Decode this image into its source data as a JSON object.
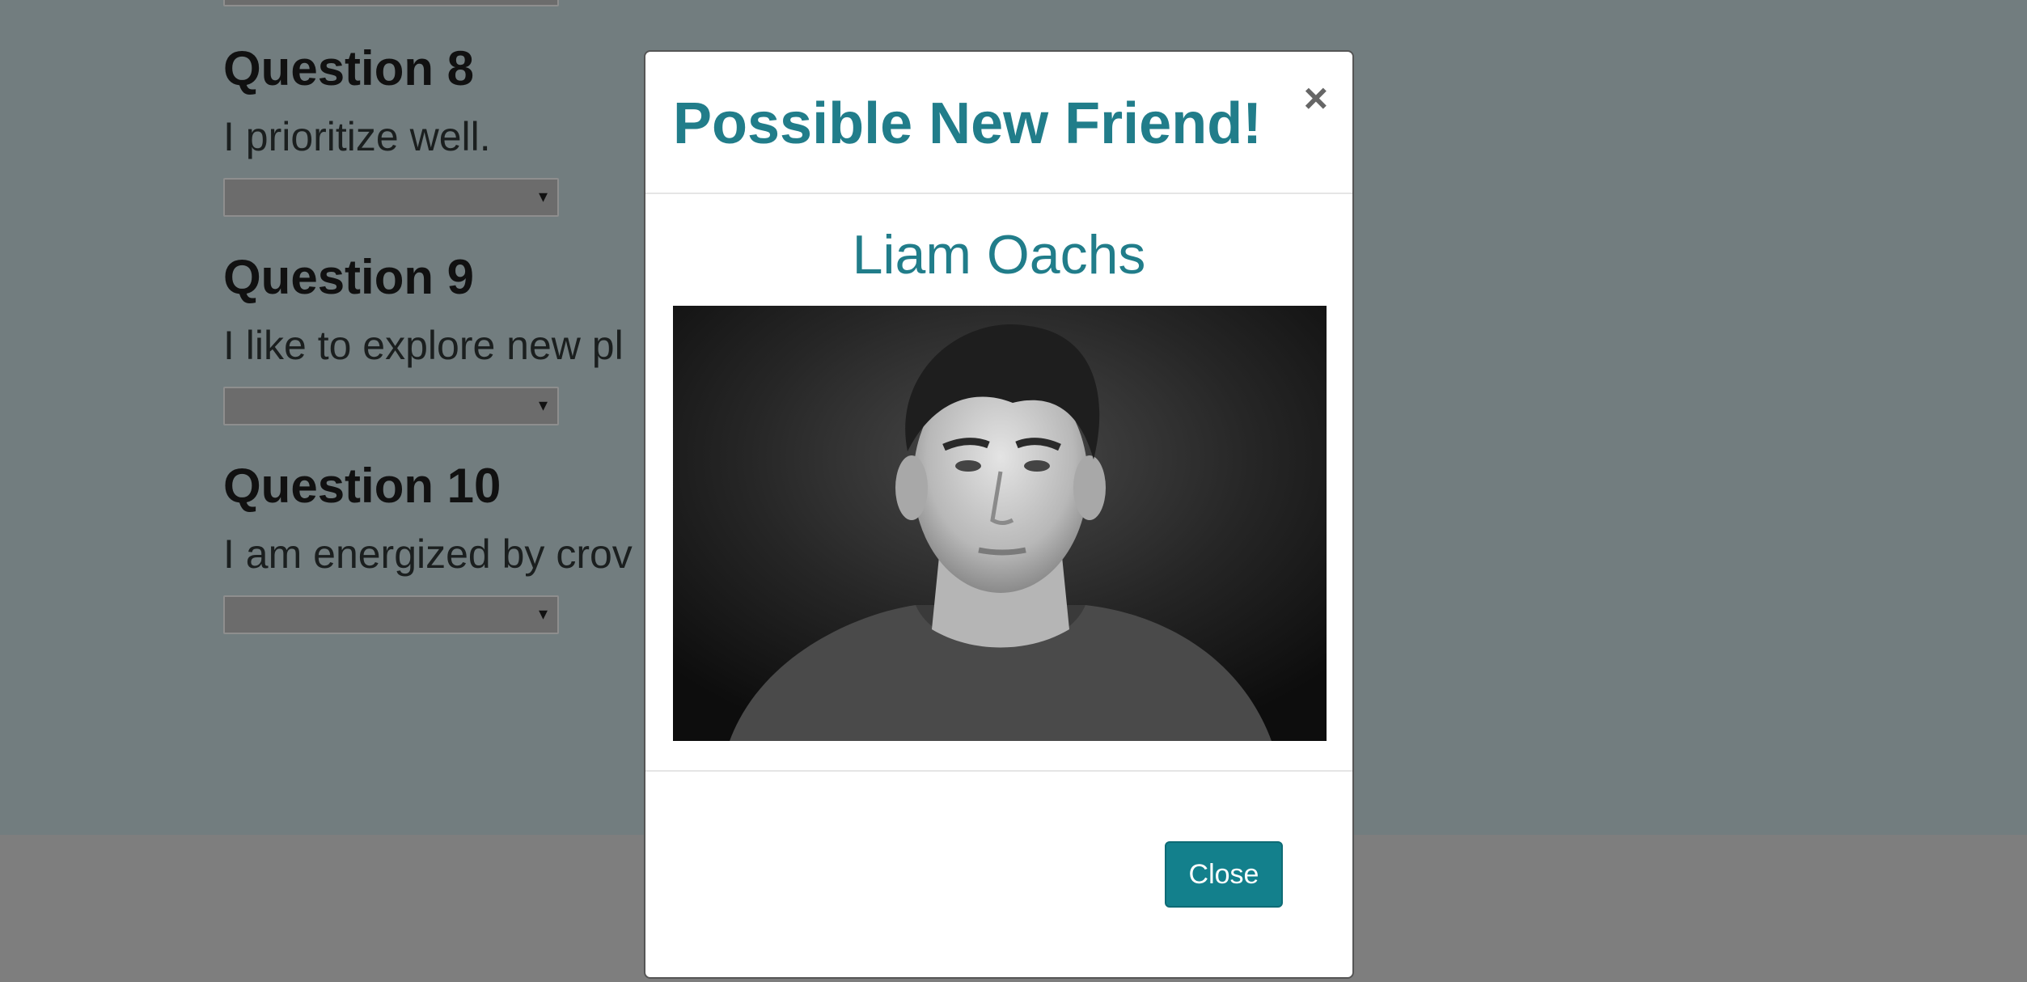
{
  "questions": [
    {
      "title": "Question 8",
      "text": "I prioritize well."
    },
    {
      "title": "Question 9",
      "text": "I like to explore new pl"
    },
    {
      "title": "Question 10",
      "text": "I am energized by crov"
    }
  ],
  "select_arrow": "▾",
  "modal": {
    "title": "Possible New Friend!",
    "close_icon": "×",
    "friend_name": "Liam Oachs",
    "close_button": "Close"
  }
}
